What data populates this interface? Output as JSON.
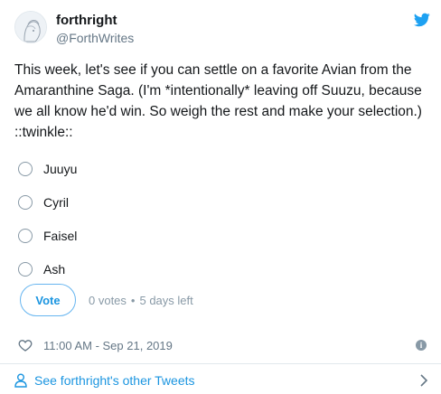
{
  "user": {
    "display_name": "forthright",
    "handle": "@ForthWrites"
  },
  "tweet": {
    "text": "This week, let's see if you can settle on a favorite Avian from the Amaranthine Saga. (I'm *intentionally* leaving off Suuzu, because we all know he'd win. So weigh the rest and make your selection.) ::twinkle::"
  },
  "poll": {
    "options": [
      {
        "label": "Juuyu"
      },
      {
        "label": "Cyril"
      },
      {
        "label": "Faisel"
      },
      {
        "label": "Ash"
      }
    ],
    "vote_label": "Vote",
    "votes_text": "0 votes",
    "separator": "•",
    "time_left": "5 days left"
  },
  "footer": {
    "timestamp": "11:00 AM - Sep 21, 2019",
    "info_glyph": "i"
  },
  "more": {
    "label": "See forthright's other Tweets"
  },
  "colors": {
    "twitter_blue": "#1da1f2",
    "link_blue": "#1b95e0",
    "muted_gray": "#657786"
  },
  "icons": [
    "avatar",
    "twitter-bird-icon",
    "heart-icon",
    "info-icon",
    "person-icon",
    "chevron-right-icon"
  ]
}
